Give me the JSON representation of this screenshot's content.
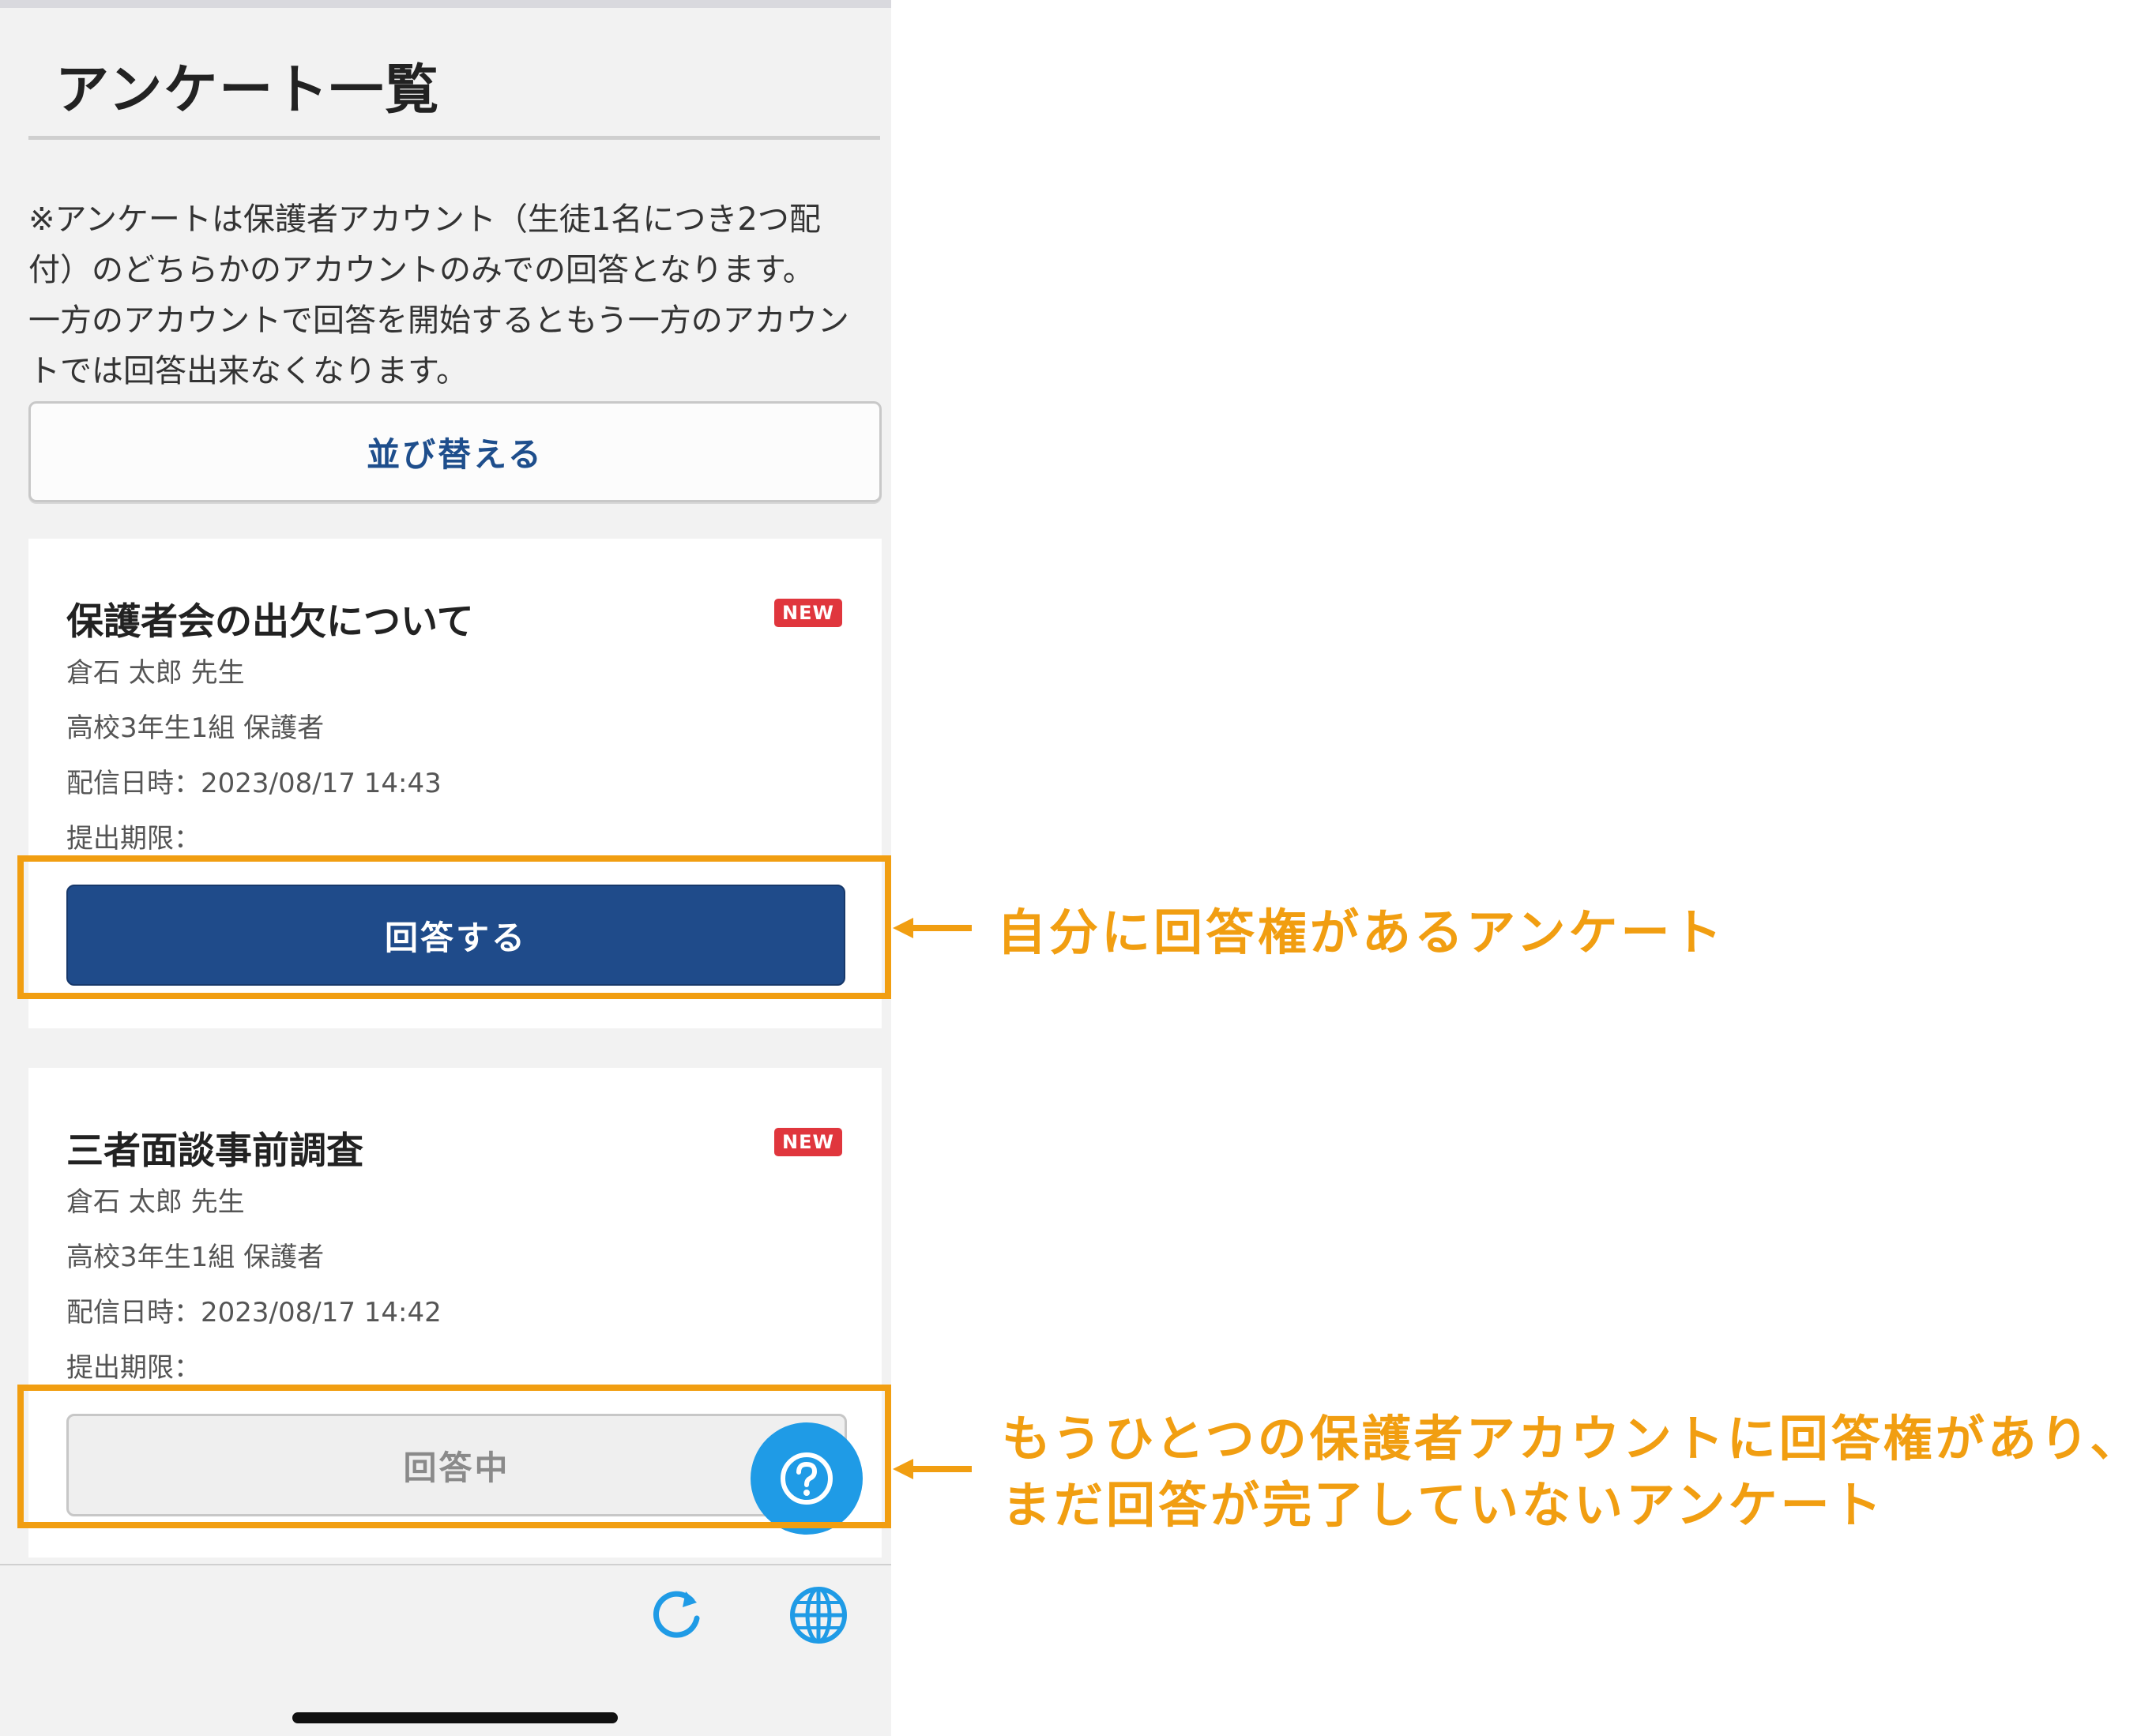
{
  "header": {
    "title": "アンケート一覧"
  },
  "notice": {
    "lines": [
      "※アンケートは保護者アカウント（生徒1名につき2つ配",
      "付）のどちらかのアカウントのみでの回答となります。",
      "一方のアカウントで回答を開始するともう一方のアカウン",
      "トでは回答出来なくなります。"
    ]
  },
  "sort_button": {
    "label": "並び替える"
  },
  "surveys": [
    {
      "title": "保護者会の出欠について",
      "badge": "NEW",
      "teacher": "倉石 太郎 先生",
      "target": "高校3年生1組 保護者",
      "delivered": "配信日時：2023/08/17 14:43",
      "deadline": "提出期限：",
      "button": "回答する"
    },
    {
      "title": "三者面談事前調査",
      "badge": "NEW",
      "teacher": "倉石 太郎 先生",
      "target": "高校3年生1組 保護者",
      "delivered": "配信日時：2023/08/17 14:42",
      "deadline": "提出期限：",
      "button": "回答中"
    }
  ],
  "annotations": {
    "first": "自分に回答権があるアンケート",
    "second_line1": "もうひとつの保護者アカウントに回答権があり、",
    "second_line2": "まだ回答が完了していないアンケート"
  },
  "colors": {
    "accent_orange": "#f19e11",
    "primary_blue": "#1f4b8a",
    "fab_blue": "#1f9be6",
    "badge_red": "#e0363d"
  },
  "icons": [
    "question-icon",
    "refresh-icon",
    "globe-icon"
  ]
}
